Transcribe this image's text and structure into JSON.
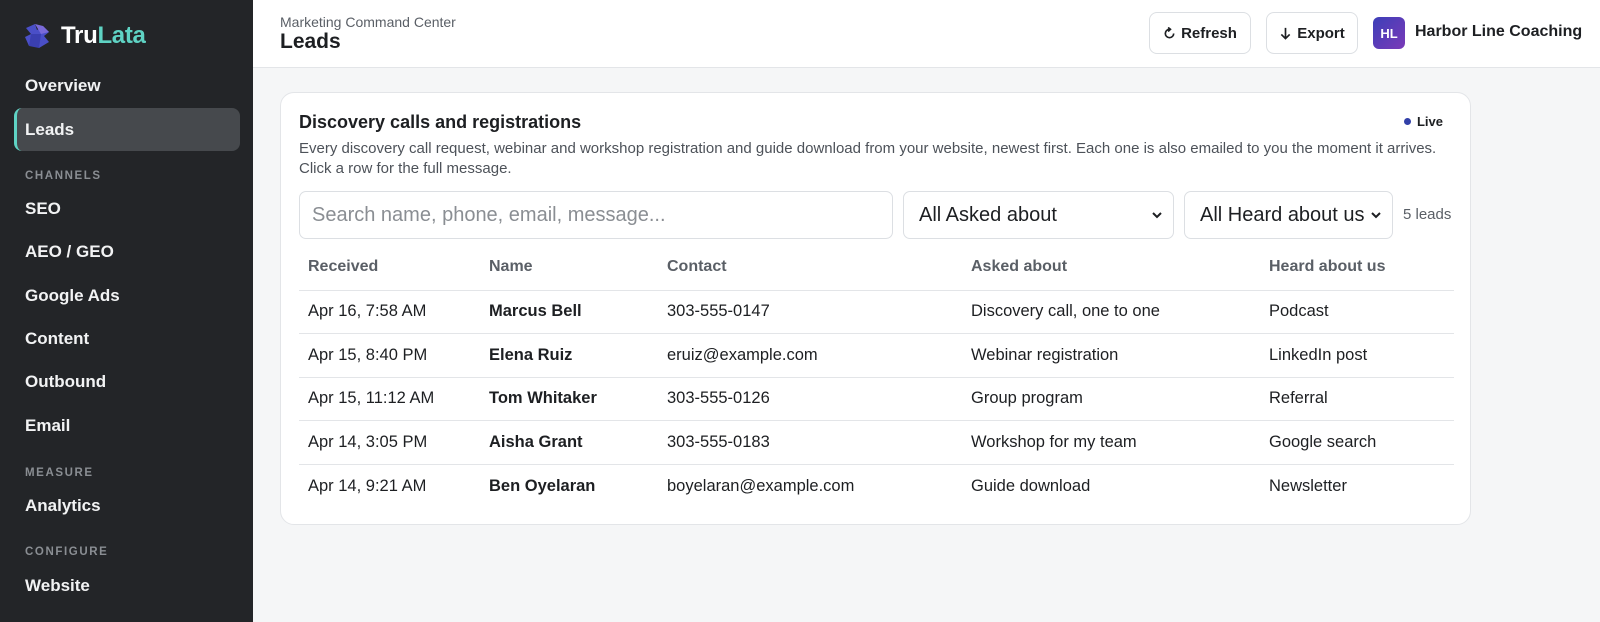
{
  "brand": {
    "name_part1": "Tru",
    "name_part2": "Lata",
    "accent_color": "#5fd3c4"
  },
  "sidebar": {
    "items": [
      {
        "label": "Overview"
      },
      {
        "label": "Leads",
        "active": true
      },
      {
        "label": "SEO"
      },
      {
        "label": "AEO / GEO"
      },
      {
        "label": "Google Ads"
      },
      {
        "label": "Content"
      },
      {
        "label": "Outbound"
      },
      {
        "label": "Email"
      },
      {
        "label": "Analytics"
      },
      {
        "label": "Website"
      }
    ],
    "sections": {
      "channels": "CHANNELS",
      "measure": "MEASURE",
      "configure": "CONFIGURE"
    }
  },
  "header": {
    "breadcrumb": "Marketing Command Center",
    "title": "Leads",
    "refresh_label": "Refresh",
    "export_label": "Export",
    "avatar_initials": "HL",
    "org_name": "Harbor Line Coaching"
  },
  "card": {
    "title": "Discovery calls and registrations",
    "live_label": "Live",
    "description": "Every discovery call request, webinar and workshop registration and guide download from your website, newest first. Each one is also emailed to you the moment it arrives. Click a row for the full message.",
    "search_placeholder": "Search name, phone, email, message...",
    "filter_asked": "All Asked about",
    "filter_heard": "All Heard about us",
    "count": "5 leads"
  },
  "table": {
    "columns": [
      "Received",
      "Name",
      "Contact",
      "Asked about",
      "Heard about us"
    ],
    "rows": [
      [
        "Apr 16, 7:58 AM",
        "Marcus Bell",
        "303-555-0147",
        "Discovery call, one to one",
        "Podcast"
      ],
      [
        "Apr 15, 8:40 PM",
        "Elena Ruiz",
        "eruiz@example.com",
        "Webinar registration",
        "LinkedIn post"
      ],
      [
        "Apr 15, 11:12 AM",
        "Tom Whitaker",
        "303-555-0126",
        "Group program",
        "Referral"
      ],
      [
        "Apr 14, 3:05 PM",
        "Aisha Grant",
        "303-555-0183",
        "Workshop for my team",
        "Google search"
      ],
      [
        "Apr 14, 9:21 AM",
        "Ben Oyelaran",
        "boyelaran@example.com",
        "Guide download",
        "Newsletter"
      ]
    ]
  }
}
